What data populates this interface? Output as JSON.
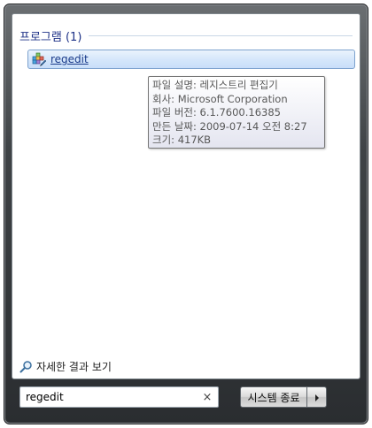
{
  "section": {
    "title": "프로그램 (1)"
  },
  "results": [
    {
      "label": "regedit",
      "icon": "registry-editor-icon"
    }
  ],
  "tooltip": {
    "lines": [
      "파일 설명: 레지스트리 편집기",
      "회사: Microsoft Corporation",
      "파일 버전: 6.1.7600.16385",
      "만든 날짜: 2009-07-14 오전 8:27",
      "크기: 417KB"
    ]
  },
  "more_results": {
    "label": "자세한 결과 보기",
    "icon": "search-icon"
  },
  "search": {
    "value": "regedit",
    "clear_icon": "close-icon",
    "clear_glyph": "×"
  },
  "shutdown": {
    "label": "시스템 종료",
    "arrow_icon": "chevron-right-icon"
  },
  "colors": {
    "accent_text": "#1e3287",
    "selection_border": "#7da2ce",
    "selection_fill": "#d6e7fb"
  }
}
